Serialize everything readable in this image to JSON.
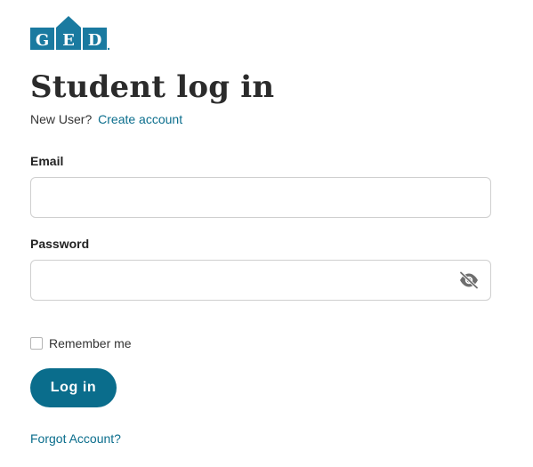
{
  "logo": {
    "letters": [
      "G",
      "E",
      "D"
    ],
    "color": "#1a7aa0",
    "icon": "ged-logo"
  },
  "page": {
    "title": "Student log in"
  },
  "signup": {
    "prompt": "New User?",
    "link_label": "Create account"
  },
  "form": {
    "email_label": "Email",
    "email_value": "",
    "password_label": "Password",
    "password_value": "",
    "password_toggle_icon": "eye-off-icon",
    "remember_label": "Remember me",
    "remember_checked": false,
    "submit_label": "Log in"
  },
  "footer": {
    "forgot_label": "Forgot Account?"
  },
  "colors": {
    "accent": "#0a6d8c",
    "title": "#2b2b2b",
    "border": "#cfcfcf"
  }
}
